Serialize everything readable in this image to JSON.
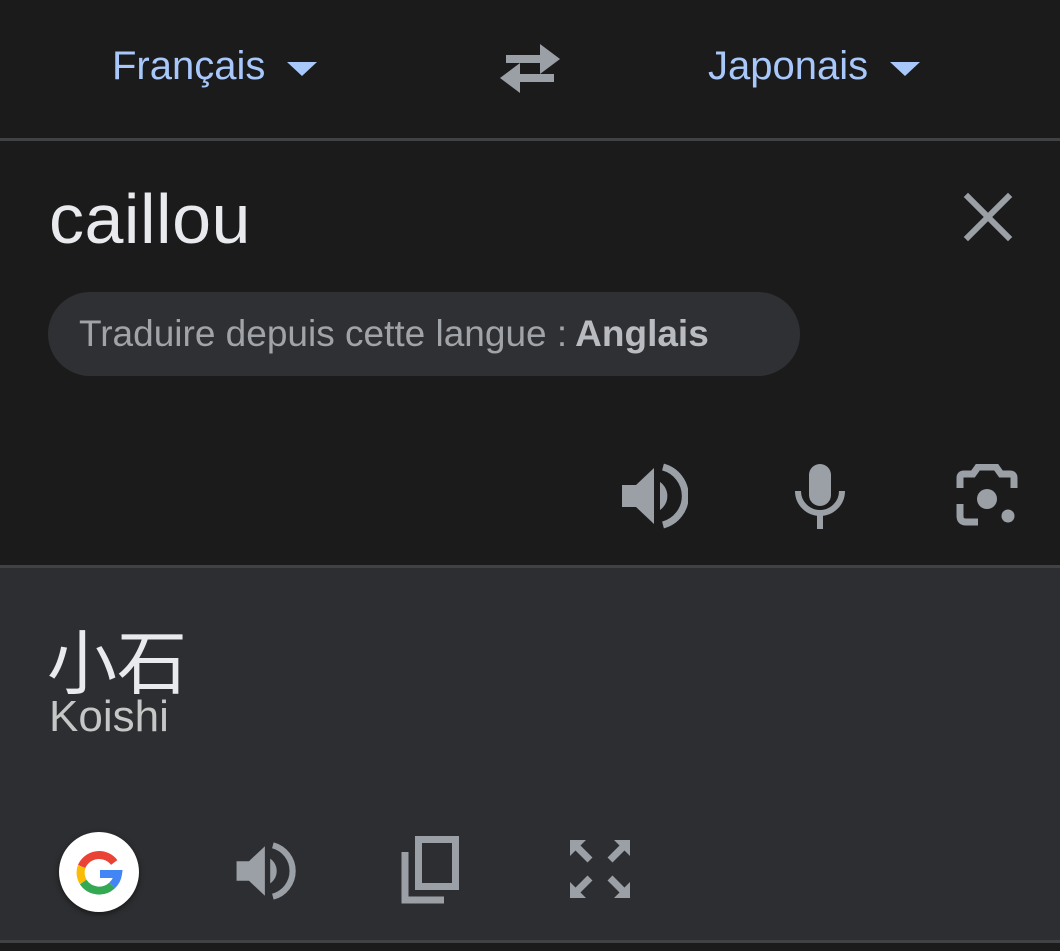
{
  "header": {
    "source_language": "Français",
    "target_language": "Japonais",
    "swap_icon": "swap-arrows-icon",
    "accent_color": "#a8c7fa"
  },
  "source": {
    "text": "caillou",
    "detect_prefix": "Traduire depuis cette langue :",
    "detected_language": "Anglais",
    "icons": [
      "close-icon",
      "speaker-icon",
      "microphone-icon",
      "camera-lens-icon"
    ]
  },
  "result": {
    "text": "小石",
    "romanization": "Koishi",
    "icons": [
      "google-logo-icon",
      "speaker-icon",
      "copy-icon",
      "fullscreen-icon"
    ]
  },
  "colors": {
    "background": "#1b1b1c",
    "result_background": "#2d2e31",
    "icon": "#9aa0a6",
    "chip": "#2f3033"
  }
}
